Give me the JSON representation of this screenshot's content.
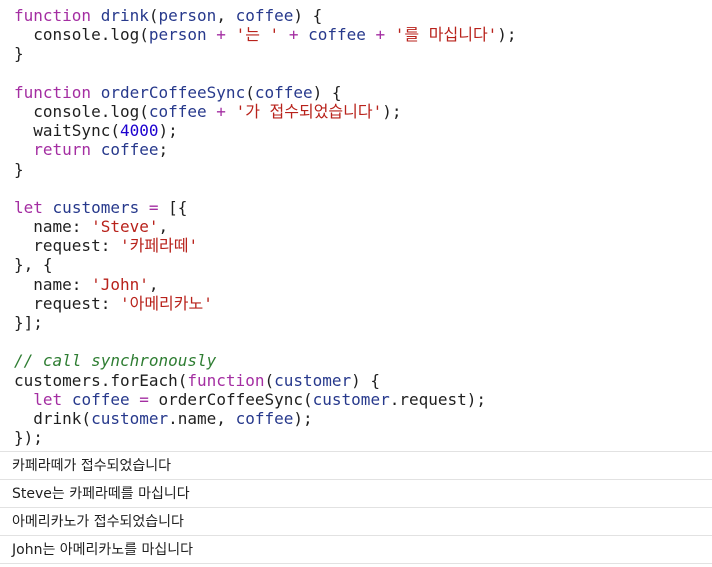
{
  "code_lines": [
    [
      {
        "t": "function",
        "c": "keyword"
      },
      {
        "t": " ",
        "c": "punct"
      },
      {
        "t": "drink",
        "c": "ident"
      },
      {
        "t": "(",
        "c": "punct"
      },
      {
        "t": "person",
        "c": "ident"
      },
      {
        "t": ", ",
        "c": "punct"
      },
      {
        "t": "coffee",
        "c": "ident"
      },
      {
        "t": ") {",
        "c": "punct"
      }
    ],
    [
      {
        "t": "  console.log(",
        "c": "punct"
      },
      {
        "t": "person",
        "c": "ident"
      },
      {
        "t": " + ",
        "c": "keyword"
      },
      {
        "t": "'는 '",
        "c": "string"
      },
      {
        "t": " + ",
        "c": "keyword"
      },
      {
        "t": "coffee",
        "c": "ident"
      },
      {
        "t": " + ",
        "c": "keyword"
      },
      {
        "t": "'를 마십니다'",
        "c": "string"
      },
      {
        "t": ");",
        "c": "punct"
      }
    ],
    [
      {
        "t": "}",
        "c": "punct"
      }
    ],
    [],
    [
      {
        "t": "function",
        "c": "keyword"
      },
      {
        "t": " ",
        "c": "punct"
      },
      {
        "t": "orderCoffeeSync",
        "c": "ident"
      },
      {
        "t": "(",
        "c": "punct"
      },
      {
        "t": "coffee",
        "c": "ident"
      },
      {
        "t": ") {",
        "c": "punct"
      }
    ],
    [
      {
        "t": "  console.log(",
        "c": "punct"
      },
      {
        "t": "coffee",
        "c": "ident"
      },
      {
        "t": " + ",
        "c": "keyword"
      },
      {
        "t": "'가 접수되었습니다'",
        "c": "string"
      },
      {
        "t": ");",
        "c": "punct"
      }
    ],
    [
      {
        "t": "  waitSync(",
        "c": "punct"
      },
      {
        "t": "4000",
        "c": "number"
      },
      {
        "t": ");",
        "c": "punct"
      }
    ],
    [
      {
        "t": "  ",
        "c": "punct"
      },
      {
        "t": "return",
        "c": "keyword"
      },
      {
        "t": " ",
        "c": "punct"
      },
      {
        "t": "coffee",
        "c": "ident"
      },
      {
        "t": ";",
        "c": "punct"
      }
    ],
    [
      {
        "t": "}",
        "c": "punct"
      }
    ],
    [],
    [
      {
        "t": "let",
        "c": "keyword"
      },
      {
        "t": " ",
        "c": "punct"
      },
      {
        "t": "customers",
        "c": "ident"
      },
      {
        "t": " = ",
        "c": "keyword"
      },
      {
        "t": "[{",
        "c": "punct"
      }
    ],
    [
      {
        "t": "  name: ",
        "c": "punct"
      },
      {
        "t": "'Steve'",
        "c": "string"
      },
      {
        "t": ",",
        "c": "punct"
      }
    ],
    [
      {
        "t": "  request: ",
        "c": "punct"
      },
      {
        "t": "'카페라떼'",
        "c": "string"
      }
    ],
    [
      {
        "t": "}, {",
        "c": "punct"
      }
    ],
    [
      {
        "t": "  name: ",
        "c": "punct"
      },
      {
        "t": "'John'",
        "c": "string"
      },
      {
        "t": ",",
        "c": "punct"
      }
    ],
    [
      {
        "t": "  request: ",
        "c": "punct"
      },
      {
        "t": "'아메리카노'",
        "c": "string"
      }
    ],
    [
      {
        "t": "}];",
        "c": "punct"
      }
    ],
    [],
    [
      {
        "t": "// call synchronously",
        "c": "comment"
      }
    ],
    [
      {
        "t": "customers.forEach(",
        "c": "punct"
      },
      {
        "t": "function",
        "c": "keyword"
      },
      {
        "t": "(",
        "c": "punct"
      },
      {
        "t": "customer",
        "c": "ident"
      },
      {
        "t": ") {",
        "c": "punct"
      }
    ],
    [
      {
        "t": "  ",
        "c": "punct"
      },
      {
        "t": "let",
        "c": "keyword"
      },
      {
        "t": " ",
        "c": "punct"
      },
      {
        "t": "coffee",
        "c": "ident"
      },
      {
        "t": " = ",
        "c": "keyword"
      },
      {
        "t": "orderCoffeeSync(",
        "c": "punct"
      },
      {
        "t": "customer",
        "c": "ident"
      },
      {
        "t": ".request);",
        "c": "punct"
      }
    ],
    [
      {
        "t": "  drink(",
        "c": "punct"
      },
      {
        "t": "customer",
        "c": "ident"
      },
      {
        "t": ".name, ",
        "c": "punct"
      },
      {
        "t": "coffee",
        "c": "ident"
      },
      {
        "t": ");",
        "c": "punct"
      }
    ],
    [
      {
        "t": "});",
        "c": "punct"
      }
    ]
  ],
  "console_output": [
    "카페라떼가 접수되었습니다",
    "Steve는 카페라떼를 마십니다",
    "아메리카노가 접수되었습니다",
    "John는 아메리카노를 마십니다"
  ],
  "colors": {
    "keyword": "#a42ea2",
    "identifier": "#27398c",
    "string": "#b8221b",
    "number": "#1c00cf",
    "comment": "#2e7d32",
    "text": "#1f1f1f",
    "divider": "#e2e2e2"
  }
}
